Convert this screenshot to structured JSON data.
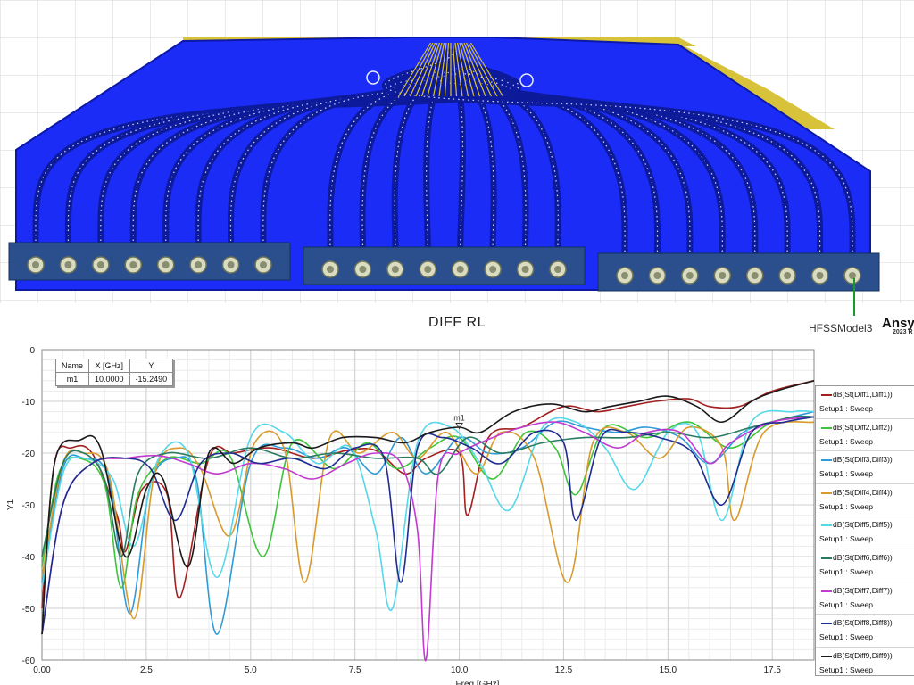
{
  "header": {
    "plot_title": "DIFF RL",
    "model_name": "HFSSModel3",
    "brand": "Ansys",
    "brand_sub": "2023 R"
  },
  "marker_table": {
    "headers": [
      "Name",
      "X [GHz]",
      "Y"
    ],
    "rows": [
      [
        "m1",
        "10.0000",
        "-15.2490"
      ]
    ]
  },
  "marker": {
    "label": "m1",
    "x": 10.0,
    "y": -15.249
  },
  "legend": {
    "items": [
      {
        "name": "dB(St(Diff1,Diff1))",
        "sub": "Setup1 : Sweep"
      },
      {
        "name": "dB(St(Diff2,Diff2))",
        "sub": "Setup1 : Sweep"
      },
      {
        "name": "dB(St(Diff3,Diff3))",
        "sub": "Setup1 : Sweep"
      },
      {
        "name": "dB(St(Diff4,Diff4))",
        "sub": "Setup1 : Sweep"
      },
      {
        "name": "dB(St(Diff5,Diff5))",
        "sub": "Setup1 : Sweep"
      },
      {
        "name": "dB(St(Diff6,Diff6))",
        "sub": "Setup1 : Sweep"
      },
      {
        "name": "dB(St(Diff7,Diff7))",
        "sub": "Setup1 : Sweep"
      },
      {
        "name": "dB(St(Diff8,Diff8))",
        "sub": "Setup1 : Sweep"
      },
      {
        "name": "dB(St(Diff9,Diff9))",
        "sub": "Setup1 : Sweep"
      }
    ]
  },
  "colors": {
    "board": "#1a2cf5",
    "board_edge": "#0b18a8",
    "gold": "#d8c23a",
    "connector": "#2a4f8c",
    "trace_dot": "#cfd8ff",
    "grid_major": "#cfcfcf",
    "grid_minor": "#ececec"
  },
  "chart_data": {
    "type": "line",
    "xlabel": "Freq [GHz]",
    "ylabel": "Y1",
    "xlim": [
      0,
      18.5
    ],
    "ylim": [
      -60,
      0
    ],
    "xticks": [
      "0.00",
      "2.5",
      "5.0",
      "7.5",
      "10.0",
      "12.5",
      "15.0",
      "17.5"
    ],
    "yticks": [
      "0",
      "-10",
      "-20",
      "-30",
      "-40",
      "-50",
      "-60"
    ],
    "grid": true,
    "legend_position": "right",
    "series": [
      {
        "name": "dB(St(Diff1,Diff1))",
        "color": "#a32020",
        "x": [
          0,
          0.3,
          0.7,
          1.2,
          1.8,
          2.0,
          2.4,
          3.0,
          3.3,
          4.0,
          4.6,
          5.5,
          6.5,
          7.3,
          8.0,
          8.7,
          9.2,
          10.0,
          10.2,
          10.7,
          11.5,
          12.5,
          13.3,
          14.0,
          14.7,
          15.5,
          16.0,
          16.7,
          17.5,
          18.5
        ],
        "y": [
          -50,
          -22,
          -19,
          -20,
          -32,
          -39,
          -27,
          -28,
          -48,
          -21,
          -20,
          -19,
          -21,
          -19.5,
          -19.5,
          -24,
          -21,
          -20,
          -32,
          -17,
          -15,
          -11,
          -12,
          -11,
          -10,
          -9.5,
          -11,
          -11,
          -8,
          -6
        ]
      },
      {
        "name": "dB(St(Diff2,Diff2))",
        "color": "#3ec43a",
        "x": [
          0,
          0.4,
          0.9,
          1.5,
          1.9,
          2.3,
          3.0,
          3.8,
          4.5,
          5.3,
          6.0,
          7.0,
          7.8,
          8.5,
          9.3,
          10.0,
          10.8,
          11.6,
          12.3,
          12.8,
          13.5,
          14.5,
          15.5,
          16.5,
          17.5,
          18.5
        ],
        "y": [
          -42,
          -24,
          -21,
          -26,
          -46,
          -28,
          -21,
          -22,
          -20.5,
          -40,
          -18,
          -23,
          -18,
          -23,
          -19,
          -17,
          -25,
          -16,
          -19,
          -28,
          -15,
          -17,
          -14,
          -19,
          -14,
          -13
        ]
      },
      {
        "name": "dB(St(Diff3,Diff3))",
        "color": "#2e9ad8",
        "x": [
          0,
          0.5,
          1.0,
          1.6,
          2.1,
          2.6,
          3.2,
          3.7,
          4.2,
          5.0,
          5.8,
          6.6,
          7.3,
          8.0,
          8.6,
          9.2,
          10.0,
          10.7,
          11.5,
          12.3,
          13.0,
          13.8,
          14.5,
          15.3,
          16.0,
          16.8,
          17.5,
          18.5
        ],
        "y": [
          -45,
          -23,
          -21,
          -25,
          -51,
          -26,
          -21,
          -25,
          -55,
          -22,
          -19,
          -21,
          -19,
          -24,
          -17,
          -24,
          -17,
          -20,
          -19,
          -14,
          -15,
          -16,
          -15,
          -17,
          -22,
          -16,
          -14,
          -12
        ]
      },
      {
        "name": "dB(St(Diff4,Diff4))",
        "color": "#d89a2a",
        "x": [
          0,
          0.5,
          1.0,
          1.6,
          2.2,
          2.7,
          3.3,
          3.8,
          4.5,
          5.1,
          5.8,
          6.3,
          6.9,
          7.6,
          8.4,
          9.0,
          9.7,
          10.4,
          11.0,
          11.8,
          12.6,
          13.2,
          14.0,
          14.8,
          15.5,
          16.3,
          16.6,
          17.3,
          18.5
        ],
        "y": [
          -44,
          -22,
          -20,
          -24,
          -52,
          -24,
          -19,
          -23,
          -36,
          -18,
          -19,
          -45,
          -17,
          -20,
          -16,
          -21,
          -16,
          -24,
          -16,
          -21,
          -45,
          -18,
          -16,
          -21,
          -15,
          -19,
          -33,
          -16,
          -14
        ]
      },
      {
        "name": "dB(St(Diff5,Diff5))",
        "color": "#55d8e8",
        "x": [
          0,
          0.5,
          1.0,
          1.7,
          2.2,
          2.8,
          3.5,
          4.2,
          5.0,
          5.8,
          6.6,
          7.4,
          8.0,
          8.4,
          9.0,
          9.8,
          10.5,
          11.2,
          12.0,
          12.8,
          13.5,
          14.2,
          15.0,
          15.7,
          16.3,
          17.0,
          18.0,
          18.5
        ],
        "y": [
          -46,
          -24,
          -21,
          -25,
          -38,
          -21,
          -20,
          -44,
          -17,
          -16,
          -22,
          -19,
          -35,
          -50,
          -18,
          -15,
          -22,
          -31,
          -15,
          -14,
          -19,
          -27,
          -16,
          -16,
          -33,
          -14,
          -12,
          -12
        ]
      },
      {
        "name": "dB(St(Diff6,Diff6))",
        "color": "#2a7a60",
        "x": [
          0,
          0.5,
          1.0,
          1.5,
          1.9,
          2.3,
          3.0,
          4.0,
          5.0,
          6.0,
          7.0,
          8.0,
          9.0,
          9.5,
          10.2,
          11.0,
          12.0,
          13.0,
          14.0,
          15.0,
          16.0,
          17.0,
          18.0,
          18.5
        ],
        "y": [
          -40,
          -22,
          -20,
          -25,
          -40,
          -24,
          -20,
          -21,
          -19,
          -21,
          -20,
          -21,
          -21,
          -24,
          -17,
          -20,
          -18,
          -17,
          -17,
          -16,
          -17,
          -15,
          -13,
          -13
        ]
      },
      {
        "name": "dB(St(Diff7,Diff7))",
        "color": "#c23ad0",
        "x": [
          0,
          0.5,
          1.2,
          2.0,
          2.8,
          3.5,
          4.2,
          5.0,
          5.8,
          6.5,
          7.3,
          8.0,
          8.6,
          9.0,
          9.2,
          9.5,
          10.0,
          10.8,
          11.5,
          12.3,
          13.0,
          13.8,
          14.5,
          15.3,
          16.0,
          16.5,
          17.5,
          18.5
        ],
        "y": [
          -55,
          -30,
          -22,
          -21,
          -20.5,
          -22,
          -24,
          -22,
          -23,
          -25,
          -22,
          -20,
          -22,
          -35,
          -60,
          -24,
          -20,
          -17,
          -15,
          -14,
          -16,
          -19,
          -16,
          -16,
          -22,
          -18,
          -14,
          -13
        ]
      },
      {
        "name": "dB(St(Diff8,Diff8))",
        "color": "#1f2c90",
        "x": [
          0,
          0.5,
          1.2,
          2.0,
          2.6,
          3.2,
          3.8,
          4.5,
          5.2,
          6.0,
          6.8,
          7.5,
          8.2,
          8.6,
          9.0,
          9.6,
          10.3,
          11.0,
          11.8,
          12.5,
          12.8,
          13.4,
          14.0,
          14.8,
          15.6,
          16.3,
          17.0,
          17.8,
          18.5
        ],
        "y": [
          -55,
          -30,
          -22,
          -21,
          -23,
          -33,
          -22,
          -20,
          -22,
          -21,
          -23,
          -19,
          -21,
          -45,
          -19,
          -17,
          -19,
          -22,
          -16,
          -18,
          -33,
          -17,
          -16,
          -17,
          -20,
          -30,
          -16,
          -14,
          -13
        ]
      },
      {
        "name": "dB(St(Diff9,Diff9))",
        "color": "#1a1a1a",
        "x": [
          0,
          0.3,
          0.9,
          1.4,
          2.0,
          2.5,
          2.9,
          3.5,
          4.0,
          4.6,
          5.2,
          6.0,
          6.5,
          7.2,
          8.0,
          8.7,
          9.3,
          10.0,
          10.5,
          11.3,
          12.2,
          13.0,
          13.6,
          14.3,
          15.0,
          15.7,
          16.3,
          17.0,
          17.6,
          18.5
        ],
        "y": [
          -55,
          -22,
          -17.5,
          -19,
          -40,
          -27,
          -25,
          -42,
          -20,
          -22,
          -19,
          -18,
          -19,
          -17,
          -17,
          -18,
          -16,
          -15,
          -16,
          -12,
          -10.5,
          -12,
          -11,
          -10,
          -9,
          -11,
          -14,
          -10,
          -8,
          -6
        ]
      }
    ]
  }
}
